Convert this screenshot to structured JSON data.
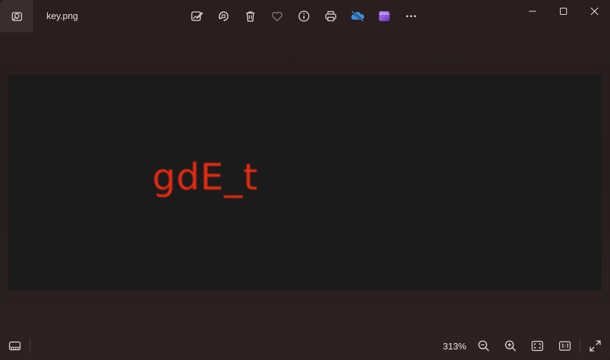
{
  "window": {
    "filename": "key.png"
  },
  "toolbar": {
    "items": [
      {
        "name": "edit-image",
        "icon": "edit-image-icon"
      },
      {
        "name": "rotate",
        "icon": "rotate-icon"
      },
      {
        "name": "delete",
        "icon": "trash-icon"
      },
      {
        "name": "favorite",
        "icon": "heart-icon"
      },
      {
        "name": "file-info",
        "icon": "info-icon"
      },
      {
        "name": "print",
        "icon": "printer-icon"
      },
      {
        "name": "onedrive",
        "icon": "cloud-off-icon"
      },
      {
        "name": "clipchamp",
        "icon": "clipchamp-icon"
      },
      {
        "name": "see-more",
        "icon": "more-icon"
      }
    ]
  },
  "window_controls": {
    "minimize": "minimize-icon",
    "maximize": "maximize-icon",
    "close": "close-icon"
  },
  "image": {
    "text": "gdE_t",
    "text_color": "#e42a12",
    "background": "#1b1b1b"
  },
  "bottombar": {
    "zoom": "313%",
    "buttons": [
      "zoom-out-icon",
      "zoom-in-icon",
      "fit-to-window-icon",
      "actual-size-icon",
      "fullscreen-icon"
    ]
  },
  "colors": {
    "onedrive_accent": "#3a8fe0",
    "clipchamp_accent": "#8b4fd8"
  }
}
